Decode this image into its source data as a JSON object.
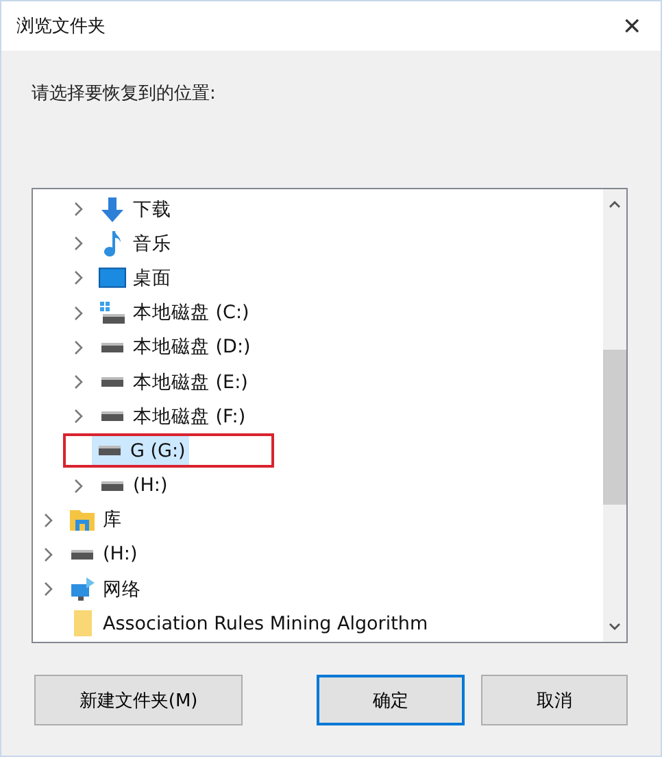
{
  "window": {
    "title": "浏览文件夹",
    "close": "✕"
  },
  "prompt": "请选择要恢复到的位置:",
  "tree": {
    "items": [
      {
        "children": [
          {
            "label": "下载",
            "kind": "download",
            "expandable": true,
            "selected": false
          },
          {
            "label": "音乐",
            "kind": "music",
            "expandable": true,
            "selected": false
          },
          {
            "label": "桌面",
            "kind": "desktop",
            "expandable": true,
            "selected": false
          },
          {
            "label": "本地磁盘 (C:)",
            "kind": "system-drive",
            "expandable": true,
            "selected": false
          },
          {
            "label": "本地磁盘 (D:)",
            "kind": "drive",
            "expandable": true,
            "selected": false
          },
          {
            "label": "本地磁盘 (E:)",
            "kind": "drive",
            "expandable": true,
            "selected": false
          },
          {
            "label": "本地磁盘 (F:)",
            "kind": "drive",
            "expandable": true,
            "selected": false
          },
          {
            "label": "G (G:)",
            "kind": "drive",
            "expandable": false,
            "selected": true,
            "highlighted": true
          },
          {
            "label": "(H:)",
            "kind": "drive",
            "expandable": true,
            "selected": false
          }
        ]
      },
      {
        "label": "库",
        "kind": "library",
        "expandable": true,
        "selected": false
      },
      {
        "label": "(H:)",
        "kind": "drive",
        "expandable": true,
        "selected": false
      },
      {
        "label": "网络",
        "kind": "network",
        "expandable": true,
        "selected": false
      },
      {
        "label": "Association Rules Mining Algorithm",
        "kind": "folder",
        "expandable": false,
        "selected": false
      }
    ]
  },
  "buttons": [
    {
      "label": "新建文件夹(M)",
      "default": false
    },
    {
      "label": "确定",
      "default": true
    },
    {
      "label": "取消",
      "default": false
    }
  ]
}
